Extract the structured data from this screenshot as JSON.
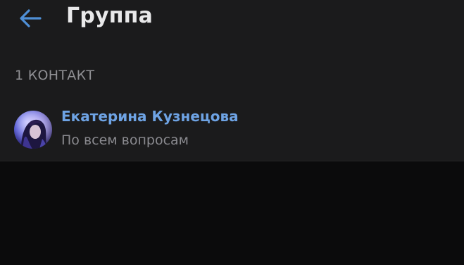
{
  "header": {
    "back_icon": "arrow-left-icon",
    "title": "Группа"
  },
  "section": {
    "label": "1 КОНТАКТ"
  },
  "contacts": [
    {
      "name": "Екатерина Кузнецова",
      "status": "По всем вопросам",
      "avatar": "user-avatar-photo"
    }
  ],
  "colors": {
    "background": "#0b0b0c",
    "card": "#1b1b1c",
    "accent": "#4f8fd6",
    "name": "#6ea3e4",
    "title": "#e9e9ea",
    "secondary_text": "#8a8a8f"
  }
}
